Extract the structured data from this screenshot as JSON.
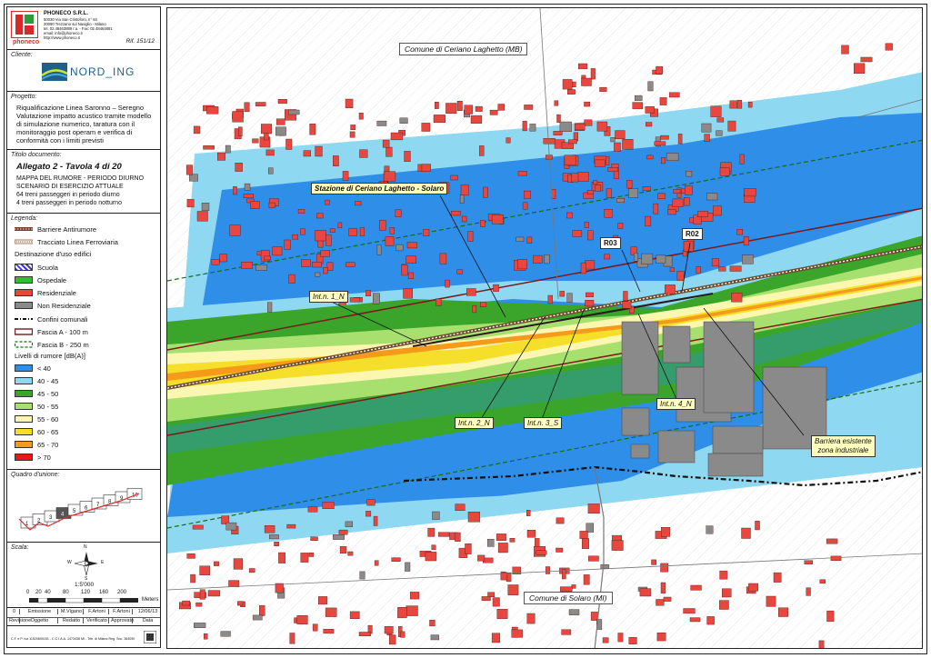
{
  "company": {
    "name": "PHONECO S.R.L.",
    "address_lines": [
      "50030 Via San Cristoforo, n° 84",
      "20090 Trezzano sul Naviglio - Milano",
      "tel. 02.48463889 r.a. - Fax: 02.48464881",
      "email: info@phoneco.it",
      "http://www.phoneco.it"
    ],
    "logo_text": "phoneco",
    "ref": "Rif. 151/12"
  },
  "client": {
    "label": "Cliente:",
    "logo_text": "NORD_ING"
  },
  "project": {
    "label": "Progetto:",
    "lines": [
      "Riqualificazione Linea Saronno – Seregno",
      "Valutazione impatto acustico tramite modello di simulazione numerico, taratura con il monitoraggio post operam e verifica di conformità con i limiti previsti"
    ]
  },
  "doc": {
    "label": "Titolo documento:",
    "title": "Allegato 2 - Tavola 4 di 20",
    "lines": [
      "MAPPA DEL RUMORE - PERIODO DIURNO",
      "SCENARIO DI ESERCIZIO ATTUALE",
      "64 treni passeggeri in periodo diurno",
      "4 treni passeggeri in periodo notturno"
    ]
  },
  "legend": {
    "label": "Legenda:",
    "lines": [
      {
        "text": "Barriere Antirumore",
        "icon": "barrier-line"
      },
      {
        "text": "Tracciato Linea Ferroviaria",
        "icon": "rail-line"
      }
    ],
    "dest_title": "Destinazione d'uso edifici",
    "uses": [
      {
        "text": "Scuola",
        "color": "#3a3acc",
        "pattern": "hatch"
      },
      {
        "text": "Ospedale",
        "color": "#2ec02e",
        "pattern": "solid"
      },
      {
        "text": "Residenziale",
        "color": "#e8473f",
        "pattern": "solid"
      },
      {
        "text": "Non Residenziale",
        "color": "#8a8a8a",
        "pattern": "solid"
      }
    ],
    "boundaries": [
      {
        "text": "Confini comunali",
        "icon": "dashdot"
      },
      {
        "text": "Fascia A - 100 m",
        "icon": "fascia-a"
      },
      {
        "text": "Fascia B - 250 m",
        "icon": "fascia-b"
      }
    ],
    "levels_title": "Livelli di rumore [dB(A)]",
    "levels": [
      {
        "text": "< 40",
        "color": "#2f8ee8"
      },
      {
        "text": "40 - 45",
        "color": "#8fd8f2"
      },
      {
        "text": "45 - 50",
        "color": "#3aa52a"
      },
      {
        "text": "50 - 55",
        "color": "#a8e070"
      },
      {
        "text": "55 - 60",
        "color": "#fbf7b0"
      },
      {
        "text": "60 - 65",
        "color": "#f5df2a"
      },
      {
        "text": "65 - 70",
        "color": "#f59a1a"
      },
      {
        "text": "> 70",
        "color": "#e81818"
      }
    ]
  },
  "index": {
    "label": "Quadro d'unione:",
    "tiles": [
      "1",
      "2",
      "3",
      "4",
      "5",
      "6",
      "7",
      "8",
      "9",
      "10"
    ]
  },
  "scale": {
    "label": "Scala:",
    "ratio": "1:5'000",
    "ticks": [
      "0",
      "20",
      "40",
      "80",
      "120",
      "160",
      "200"
    ],
    "unit": "Meters",
    "north": "N",
    "south": "S",
    "east": "E",
    "west": "W"
  },
  "revisions": {
    "row": [
      "0",
      "Emissione",
      "M.Vigano",
      "F.Artoni",
      "F.Artoni",
      "12/06/13"
    ],
    "header": [
      "Revisione",
      "Oggetto",
      "Redatto",
      "Verificato",
      "Approvato",
      "Data"
    ]
  },
  "footer": "C.F. e P. Iva 11520690151 - C.C.I.A.A. 1473438 MI - Trib. di Milano Reg. Soc. 364090",
  "map": {
    "comune_top": "Comune di Ceriano Laghetto (MB)",
    "comune_bottom": "Comune di Solaro (MI)",
    "station": "Stazione di Ceriano Laghetto - Solaro",
    "receivers": [
      "R03",
      "R02"
    ],
    "interventions": [
      "Int.n. 1_N",
      "Int.n. 2_N",
      "Int.n. 3_S",
      "Int.n. 4_N"
    ],
    "barrier_note": [
      "Barriera esistente",
      "zona industriale"
    ]
  }
}
